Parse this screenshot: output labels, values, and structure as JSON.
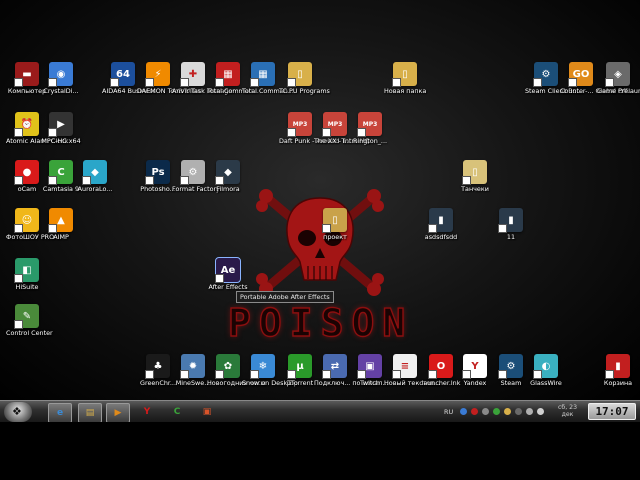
{
  "desktop_icons": [
    {
      "label": "Компьютер",
      "icon": "computer-icon",
      "color": "#9a1b1b"
    },
    {
      "label": "CrystalDi...",
      "icon": "crystaldisk-icon",
      "color": "#3a7bd5"
    },
    {
      "label": "AIDA64 Business",
      "icon": "aida64-icon",
      "color": "#1c4f9c"
    },
    {
      "label": "DAEMON Tools Ultra",
      "icon": "daemon-tools-icon",
      "color": "#f08a00"
    },
    {
      "label": "AnVir Task Manager",
      "icon": "anvir-icon",
      "color": "#d9d9d9"
    },
    {
      "label": "Total Comman...",
      "icon": "total-commander-icon",
      "color": "#c21f1f"
    },
    {
      "label": "Total Comman...",
      "icon": "total-commander-icon",
      "color": "#2a6fb5"
    },
    {
      "label": "TC PU Programs",
      "icon": "folder-icon",
      "color": "#d8b04a"
    },
    {
      "label": "Новая папка",
      "icon": "folder-icon",
      "color": "#d8b04a"
    },
    {
      "label": "Steam Client Bo...",
      "icon": "steam-icon",
      "color": "#1b4e78"
    },
    {
      "label": "Counter-... Global Off...",
      "icon": "csgo-icon",
      "color": "#e08a1a"
    },
    {
      "label": "Game Prelauncher",
      "icon": "game-prelauncher-icon",
      "color": "#6a6a6a"
    },
    {
      "label": "Atomic Alarm Clock",
      "icon": "alarm-clock-icon",
      "color": "#e0c21a"
    },
    {
      "label": "MPC-HC x64",
      "icon": "mpc-hc-icon",
      "color": "#333333"
    },
    {
      "label": "Daft Punk - Around T...",
      "icon": "mp3-icon",
      "color": "#c8443a"
    },
    {
      "label": "The XX - Intro HQ",
      "icon": "mp3-icon",
      "color": "#c8443a"
    },
    {
      "label": "Rington_...",
      "icon": "mp3-icon",
      "color": "#c8443a"
    },
    {
      "label": "oCam",
      "icon": "ocam-icon",
      "color": "#d91a1a"
    },
    {
      "label": "Camtasia 9",
      "icon": "camtasia-icon",
      "color": "#3aa33a"
    },
    {
      "label": "AuroraLo...",
      "icon": "aurora-icon",
      "color": "#2aa6c9"
    },
    {
      "label": "Photosho...",
      "icon": "photoshop-icon",
      "color": "#0b2a4a"
    },
    {
      "label": "Format Factory",
      "icon": "format-factory-icon",
      "color": "#b0b0b0"
    },
    {
      "label": "Filmora",
      "icon": "filmora-icon",
      "color": "#2b3a48"
    },
    {
      "label": "Танчеки",
      "icon": "folder-icon",
      "color": "#d8c27a"
    },
    {
      "label": "ФотоШОУ PRO",
      "icon": "fotoshow-icon",
      "color": "#f0b71a"
    },
    {
      "label": "AIMP",
      "icon": "aimp-icon",
      "color": "#f08a00"
    },
    {
      "label": "проект",
      "icon": "folder-icon",
      "color": "#c9a24a"
    },
    {
      "label": "asdsdfsdd",
      "icon": "video-file-icon",
      "color": "#2a3a4a"
    },
    {
      "label": "11",
      "icon": "video-file-icon",
      "color": "#2a3a4a"
    },
    {
      "label": "HiSuite",
      "icon": "hisuite-icon",
      "color": "#2a9a6a"
    },
    {
      "label": "After Effects",
      "icon": "after-effects-icon",
      "color": "#2a1a4a"
    },
    {
      "label": "Control Center",
      "icon": "control-center-icon",
      "color": "#4a8a3a"
    },
    {
      "label": "GreenChr...",
      "icon": "christmas-tree-icon",
      "color": "#1a1a1a"
    },
    {
      "label": "MineSwe...",
      "icon": "minesweeper-icon",
      "color": "#4a7ab0"
    },
    {
      "label": "Новогодние часы",
      "icon": "new-year-clock-icon",
      "color": "#2a7a3a"
    },
    {
      "label": "Snow on DeskTop",
      "icon": "snowflake-icon",
      "color": "#3a8ad5"
    },
    {
      "label": "µTorrent",
      "icon": "utorrent-icon",
      "color": "#2a9a2a"
    },
    {
      "label": "Подключ... по локал...",
      "icon": "network-icon",
      "color": "#4a6ab0"
    },
    {
      "label": "Twitch",
      "icon": "twitch-icon",
      "color": "#6441a5"
    },
    {
      "label": "Новый текстов...",
      "icon": "text-file-icon",
      "color": "#f0f0f0"
    },
    {
      "label": "launcher.lnk",
      "icon": "opera-icon",
      "color": "#d91a1a"
    },
    {
      "label": "Yandex",
      "icon": "yandex-icon",
      "color": "#ffffff"
    },
    {
      "label": "Steam",
      "icon": "steam-icon",
      "color": "#1b4e78"
    },
    {
      "label": "GlassWire",
      "icon": "glasswire-icon",
      "color": "#3ab0c0"
    },
    {
      "label": "Корзина",
      "icon": "recycle-bin-icon",
      "color": "#c21f1f"
    }
  ],
  "tooltip": "Portable Adobe After Effects",
  "wallpaper": {
    "logo_text": "POISON",
    "accent": "#8c0f0f"
  },
  "taskbar": {
    "pinned": [
      {
        "name": "ie-taskbar-button",
        "icon": "internet-explorer-icon",
        "glyph": "e",
        "color": "#3a8ad5"
      },
      {
        "name": "explorer-taskbar-button",
        "icon": "folder-icon",
        "glyph": "▤",
        "color": "#d8b04a"
      },
      {
        "name": "media-player-taskbar-button",
        "icon": "media-player-icon",
        "glyph": "▶",
        "color": "#e08a1a"
      },
      {
        "name": "yandex-taskbar-button",
        "icon": "yandex-icon",
        "glyph": "Y",
        "color": "#d91a1a"
      },
      {
        "name": "camtasia-taskbar-button",
        "icon": "camtasia-icon",
        "glyph": "C",
        "color": "#3aa33a"
      },
      {
        "name": "presentation-taskbar-button",
        "icon": "presentation-icon",
        "glyph": "▣",
        "color": "#d9542a"
      }
    ],
    "language": "RU",
    "date_line1": "сб, 23",
    "date_line2": "дек",
    "clock": "17:07"
  }
}
